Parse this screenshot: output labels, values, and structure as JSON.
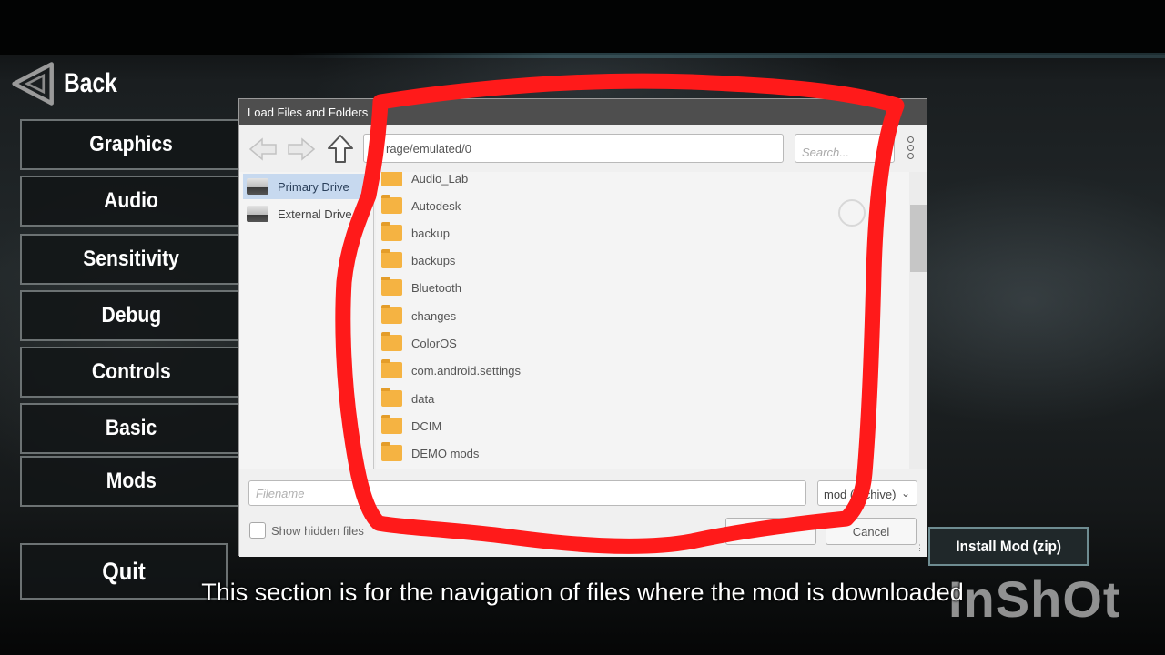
{
  "menu": {
    "back_label": "Back",
    "items": [
      {
        "label": "Graphics"
      },
      {
        "label": "Audio"
      },
      {
        "label": "Sensitivity"
      },
      {
        "label": "Debug"
      },
      {
        "label": "Controls"
      },
      {
        "label": "Basic"
      },
      {
        "label": "Mods"
      }
    ],
    "quit_label": "Quit"
  },
  "dialog": {
    "title": "Load Files and Folders",
    "path": "rage/emulated/0",
    "search_placeholder": "Search...",
    "drives": [
      {
        "label": "Primary Drive",
        "selected": true
      },
      {
        "label": "External Drive",
        "selected": false
      }
    ],
    "files": [
      {
        "name": "Audio_Lab"
      },
      {
        "name": "Autodesk"
      },
      {
        "name": "backup"
      },
      {
        "name": "backups"
      },
      {
        "name": "Bluetooth"
      },
      {
        "name": "changes"
      },
      {
        "name": "ColorOS"
      },
      {
        "name": "com.android.settings"
      },
      {
        "name": "data"
      },
      {
        "name": "DCIM"
      },
      {
        "name": "DEMO mods"
      }
    ],
    "filename_placeholder": "Filename",
    "filetype_value": "mod (archive)",
    "show_hidden_label": "Show hidden files",
    "show_hidden_checked": false,
    "cancel_label": "Cancel"
  },
  "install_label": "Install Mod (zip)",
  "caption": "This section is for the navigation of files where the mod is downloaded",
  "watermark": "InShOt",
  "colors": {
    "dialog_title_bg": "#4e4e4e",
    "selected_drive_bg": "#c7d9ef",
    "folder": "#f5b342",
    "annotation_red": "#ff1a1a",
    "install_border": "#6e8c91"
  },
  "icons": {
    "back": "back-triangle-icon",
    "nav_back": "arrow-left-icon",
    "nav_forward": "arrow-right-icon",
    "nav_up": "arrow-up-icon",
    "more": "kebab-menu-icon",
    "drive": "drive-icon",
    "folder": "folder-icon"
  }
}
